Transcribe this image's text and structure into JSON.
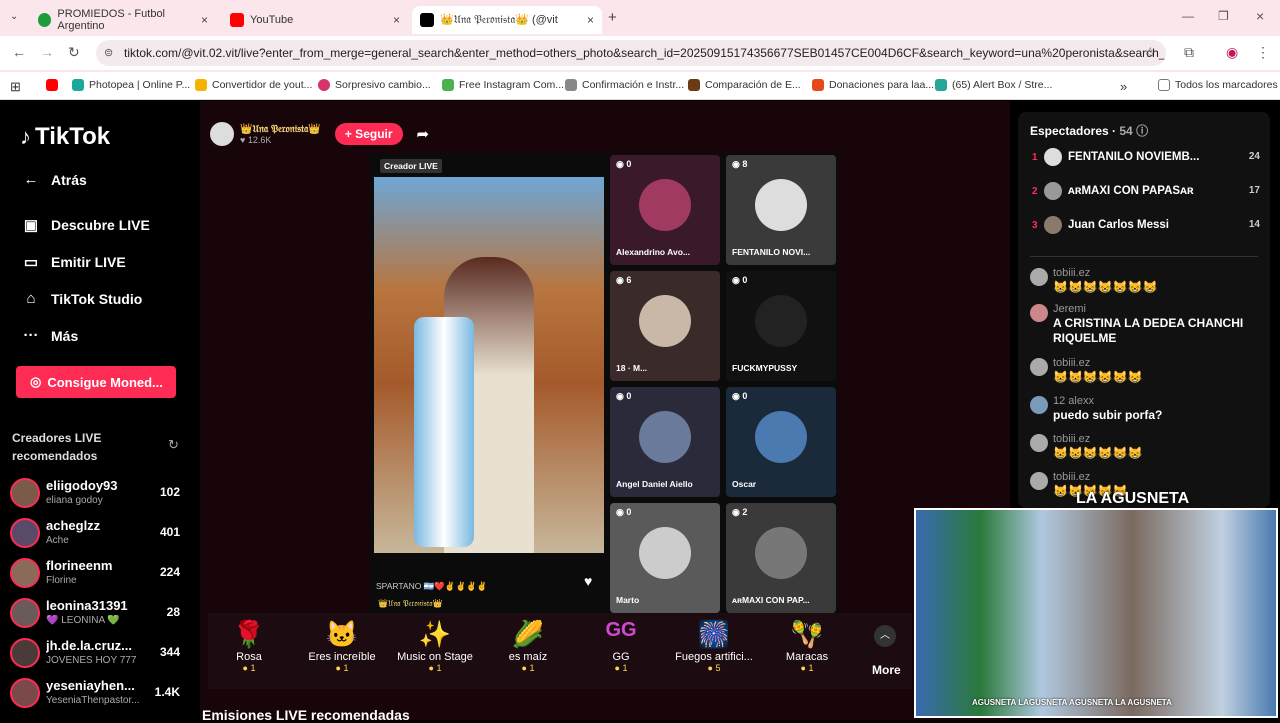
{
  "browser": {
    "tabs": [
      {
        "title": "PROMIEDOS - Futbol Argentino"
      },
      {
        "title": "YouTube"
      },
      {
        "title": "👑𝔘𝔫𝔞 𝔓𝔢𝔯𝔬𝔫𝔦𝔰𝔱𝔞👑 (@vit.0"
      }
    ],
    "url": "tiktok.com/@vit.02.vit/live?enter_from_merge=general_search&enter_method=others_photo&search_id=20250915174356677SEB01457CE004D6CF&search_keyword=una%20peronista&search_result_id...",
    "bookmarks": [
      "Photopea | Online P...",
      "Convertidor de yout...",
      "Sorpresivo cambio...",
      "Free Instagram Com...",
      "Confirmación e Instr...",
      "Comparación de E...",
      "Donaciones para laa...",
      "(65) Alert Box / Stre...",
      "Todos los marcadores"
    ]
  },
  "sidebar": {
    "logo": "TikTok",
    "nav": [
      "Atrás",
      "Descubre LIVE",
      "Emitir LIVE",
      "TikTok Studio",
      "Más"
    ],
    "coin_button": "Consigue Moned...",
    "recommended_label": "Creadores LIVE recomendados",
    "creators": [
      {
        "name": "eliigodoy93",
        "sub": "eliana godoy",
        "count": "102"
      },
      {
        "name": "acheglzz",
        "sub": "Ache",
        "count": "401"
      },
      {
        "name": "florineenm",
        "sub": "Florine",
        "count": "224"
      },
      {
        "name": "leonina31391",
        "sub": "💜 LEONINA 💚",
        "count": "28"
      },
      {
        "name": "jh.de.la.cruz...",
        "sub": "JÓVENES HOY 777",
        "count": "344"
      },
      {
        "name": "yeseniayhen...",
        "sub": "YeseniaThenpastor...",
        "count": "1.4K"
      }
    ]
  },
  "stream": {
    "host_name": "👑𝔘𝔫𝔞 𝔓𝔢𝔯𝔬𝔫𝔦𝔰𝔱𝔞👑",
    "host_likes": "12.6K",
    "follow_label": "+ Seguir",
    "creator_tag": "Creador LIVE",
    "main_caption": "SPARTANO",
    "main_footer": "👑𝔘𝔫𝔞 𝔓𝔢𝔯𝔬𝔫𝔦𝔰𝔱𝔞👑",
    "slots": [
      {
        "num": "0",
        "name": "Alexandrino Avo..."
      },
      {
        "num": "8",
        "name": "FENTANILO NOVI..."
      },
      {
        "num": "6",
        "name": "18 · M..."
      },
      {
        "num": "0",
        "name": "FUCKMYPUSSY"
      },
      {
        "num": "0",
        "name": "Angel Daniel Aiello"
      },
      {
        "num": "0",
        "name": "Oscar"
      },
      {
        "num": "0",
        "name": "Marto"
      },
      {
        "num": "2",
        "name": "ᴀʀMAXI CON PAP..."
      }
    ],
    "gifts": [
      {
        "name": "Rosa",
        "price": "1"
      },
      {
        "name": "Eres increíble",
        "price": "1"
      },
      {
        "name": "Music on Stage",
        "price": "1"
      },
      {
        "name": "es maíz",
        "price": "1"
      },
      {
        "name": "GG",
        "price": "1"
      },
      {
        "name": "Fuegos artifici...",
        "price": "5"
      },
      {
        "name": "Maracas",
        "price": "1"
      }
    ],
    "more_label": "More",
    "recommended_live_title": "Emisiones LIVE recomendadas"
  },
  "viewers": {
    "title": "Espectadores",
    "count": "54",
    "list": [
      {
        "rank": "1",
        "name": "FENTANILO NOVIEMB...",
        "score": "24"
      },
      {
        "rank": "2",
        "name": "ᴀʀMAXI CON PAPASᴀʀ",
        "score": "17"
      },
      {
        "rank": "3",
        "name": "Juan Carlos Messi",
        "score": "14"
      }
    ]
  },
  "chat": [
    {
      "user": "tobiii.ez",
      "text": "😸😸😸😸😸😸😸"
    },
    {
      "user": "Jeremi",
      "text": "A CRISTINA LA DEDEA CHANCHI RIQUELME"
    },
    {
      "user": "tobiii.ez",
      "text": "😸😸😸😸😸😸"
    },
    {
      "user": "12 alexx",
      "text": "puedo subir porfa?"
    },
    {
      "user": "tobiii.ez",
      "text": "😸😸😸😸😸😸"
    },
    {
      "user": "tobiii.ez",
      "text": "😸😸😸😸😸"
    }
  ],
  "webcam": {
    "brand": "LA AGUSNETA",
    "socials": "AGUSNETA  LAGUSNETA  AGUSNETA  LA AGUSNETA"
  }
}
